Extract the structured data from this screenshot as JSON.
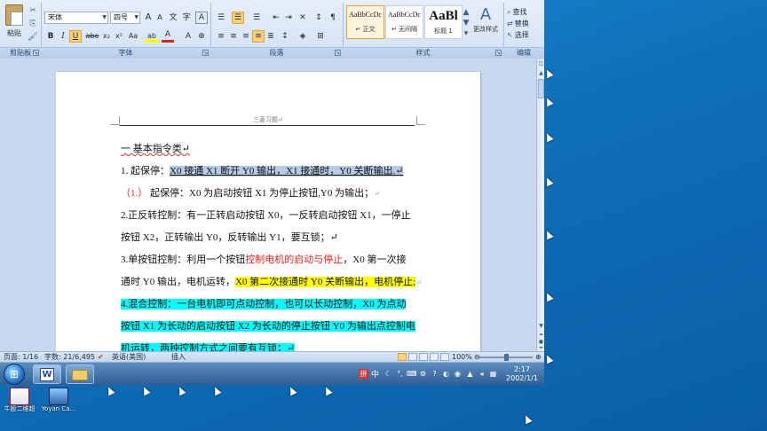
{
  "ribbon": {
    "clipboard": {
      "paste_label": "粘贴",
      "group_label": "剪贴板"
    },
    "font": {
      "group_label": "字体",
      "font_name": "宋体",
      "font_size": "四号",
      "grow_label": "A",
      "shrink_label": "A",
      "clear_label": "A",
      "bold": "B",
      "italic": "I",
      "underline": "U",
      "strike": "abe",
      "subscript": "x₂",
      "superscript": "x²",
      "case": "Aa",
      "font_color": "A",
      "highlight": "ab"
    },
    "paragraph": {
      "group_label": "段落"
    },
    "styles": {
      "group_label": "样式",
      "tiles": [
        {
          "sample": "AaBbCcDc",
          "name": "↵ 正文"
        },
        {
          "sample": "AaBbCcDc",
          "name": "↵ 无间隔"
        },
        {
          "sample": "AaBl",
          "name": "标题 1"
        }
      ],
      "change_styles_label": "更改样式",
      "change_styles_glyph": "A"
    },
    "editing": {
      "group_label": "编辑",
      "find_label": "查找",
      "replace_label": "替换",
      "select_label": "选择"
    }
  },
  "document": {
    "header": "三菱习题↵",
    "lines": {
      "l1": "一 基本指令类↵",
      "l2_prefix": "1. 起保停：",
      "l2_hl": "X0 接通 X1 断开 Y0 输出，X1 接通时，Y0 关断输出.↵",
      "l3": "（1.）  起保停：X0 为启动按钮 X1 为停止按钮,Y0 为输出；↵",
      "l3_paren": "（1.）",
      "l3_rest": "  起保停：X0 为启动按钮 X1 为停止按钮,Y0 为输出；",
      "l4": "2.正反转控制：有一正转启动按钮 X0，一反转启动按钮 X1，一停止",
      "l5": "按钮 X2，正转输出 Y0，反转输出 Y1，要互锁；↵",
      "l6_a": "3.单按钮控制：利用一个按钮",
      "l6_red": "控制电机的启动与停止",
      "l6_b": "，X0  第一次接",
      "l7_a": "通时 Y0 输出，电机运转，",
      "l7_hl": "X0 第二次接通时 Y0 关断输出，电机停止;",
      "l8": "4.混合控制：一台电机即可点动控制，也可以长动控制，X0  为点动",
      "l9": "按钮 X1 为长动的启动按钮 X2 为长动的停止按钮 Y0 为输出点控制电",
      "l10": "机运转，两种控制方式之间要有互锁；↵"
    }
  },
  "status_bar": {
    "page": "页面: 1/16",
    "words": "字数: 21/6,495",
    "language": "英语(美国)",
    "mode": "插入",
    "zoom": "100%",
    "zoom_fraction": 0.5
  },
  "taskbar": {
    "ime": "中",
    "time": "2:17",
    "date": "2002/1/1"
  },
  "desktop": {
    "icons": [
      {
        "label": "牛股二维超"
      },
      {
        "label": "Yoyan Ca..."
      }
    ]
  },
  "colors": {
    "highlight_blue": "#b6cbe6",
    "highlight_yellow": "#ffff00",
    "highlight_cyan": "#00ffff",
    "text_red": "#e2231a",
    "desktop_blue": "#0e6fb8"
  }
}
